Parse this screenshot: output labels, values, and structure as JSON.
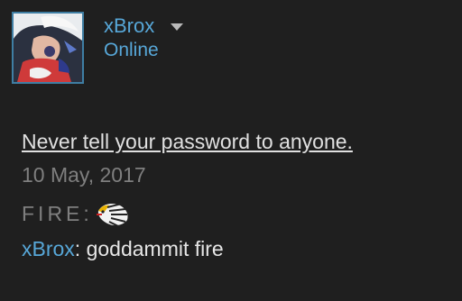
{
  "profile": {
    "username": "xBrox",
    "status": "Online",
    "avatar_icon": "anime-character-avatar",
    "dropdown_icon": "caret-down-icon"
  },
  "chat": {
    "notice": "Never tell your password to anyone.",
    "date": "10 May, 2017",
    "messages": [
      {
        "sender": "FIRE",
        "separator": ":",
        "text": "",
        "emote": "pokemon-emoticon"
      },
      {
        "sender": "xBrox",
        "separator": ":",
        "text": " goddammit fire"
      }
    ]
  },
  "colors": {
    "background": "#1f1f1f",
    "accent": "#57a7d8",
    "muted": "#7f7f7f",
    "text": "#e6e6e6"
  }
}
